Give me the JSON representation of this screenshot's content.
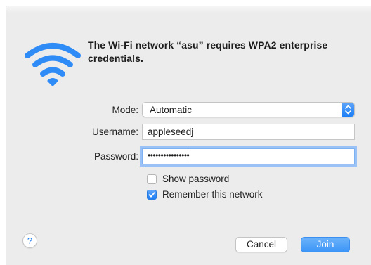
{
  "dialog": {
    "heading": "The Wi-Fi network “asu” requires WPA2 enterprise credentials.",
    "icon": "wifi-icon"
  },
  "form": {
    "mode_label": "Mode:",
    "mode_value": "Automatic",
    "username_label": "Username:",
    "username_value": "appleseedj",
    "password_label": "Password:",
    "password_value": "••••••••••••••••"
  },
  "options": {
    "show_password_label": "Show password",
    "show_password_checked": false,
    "remember_label": "Remember this network",
    "remember_checked": true
  },
  "buttons": {
    "help_label": "?",
    "cancel_label": "Cancel",
    "join_label": "Join"
  },
  "colors": {
    "accent": "#2f8cf6",
    "window_background": "#ececec"
  }
}
